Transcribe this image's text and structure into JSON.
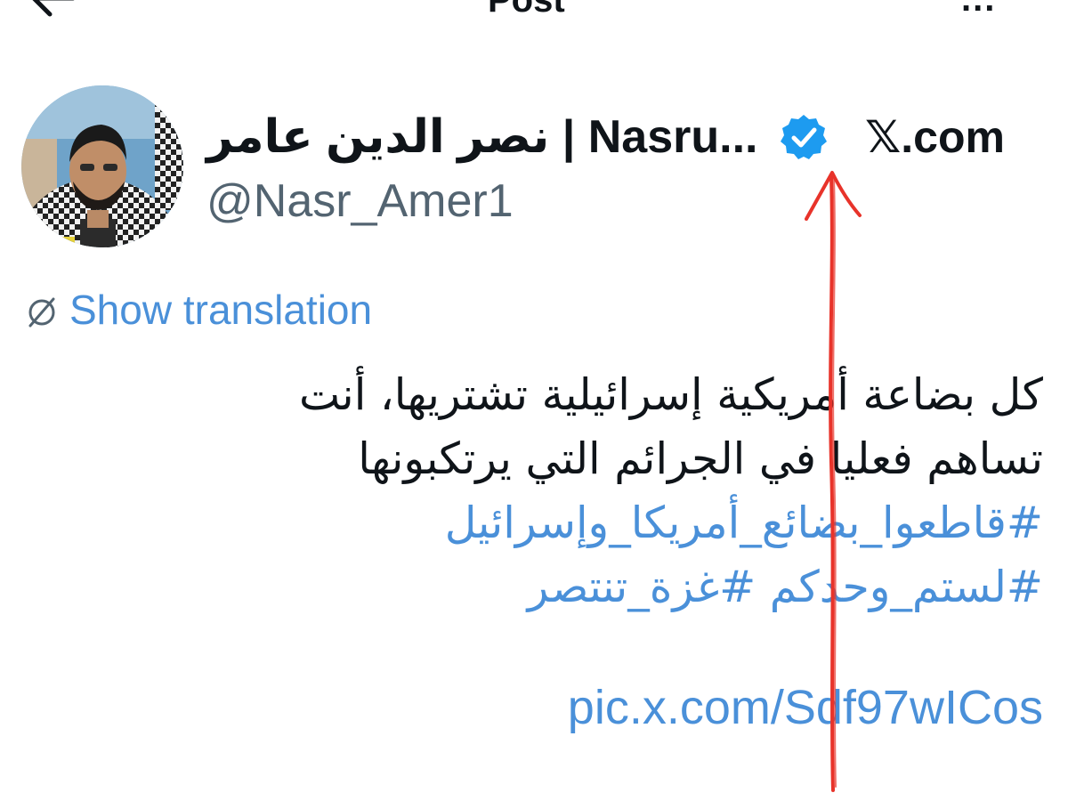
{
  "topbar": {
    "title": "Post",
    "back_icon": "arrow-left-icon",
    "more_label": "..."
  },
  "author": {
    "display_name": "نصر الدين عامر | Nasru...",
    "handle": "@Nasr_Amer1",
    "verified": true,
    "badge_color": "#1d9bf0"
  },
  "source_label": "𝕏.com",
  "translation": {
    "icon": "globe-icon",
    "label": "Show translation"
  },
  "tweet": {
    "line1": "كل بضاعة أمريكية إسرائيلية تشتريها، أنت",
    "line2": "تساهم فعليا في الجرائم التي يرتكبونها",
    "hashtag1": "#قاطعوا_بضائع_أمريكا_وإسرائيل",
    "hashtag2": "#لستم_وحدكم",
    "hashtag3": "#غزة_تنتصر",
    "pic_link": "pic.x.com/Sdf97wICos"
  },
  "colors": {
    "link": "#4a90d9",
    "text": "#0f1419",
    "muted": "#536471",
    "annotation_arrow": "#e8332a"
  }
}
